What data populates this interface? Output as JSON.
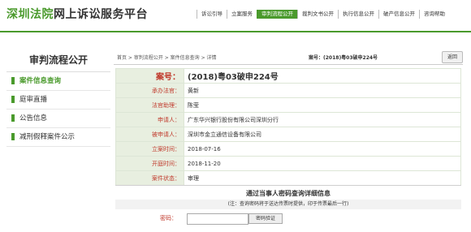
{
  "brand": {
    "part1": "深圳法院",
    "part2": "网上诉讼服务平台"
  },
  "topnav": [
    {
      "label": "诉讼引导",
      "active": false
    },
    {
      "label": "立案服务",
      "active": false
    },
    {
      "label": "审判流程公开",
      "active": true
    },
    {
      "label": "裁判文书公开",
      "active": false
    },
    {
      "label": "执行信息公开",
      "active": false
    },
    {
      "label": "破产信息公开",
      "active": false
    },
    {
      "label": "咨询帮助",
      "active": false
    }
  ],
  "sidebar": {
    "title": "审判流程公开",
    "items": [
      {
        "label": "案件信息查询",
        "active": true
      },
      {
        "label": "庭审直播",
        "active": false
      },
      {
        "label": "公告信息",
        "active": false
      },
      {
        "label": "减刑假释案件公示",
        "active": false
      }
    ]
  },
  "breadcrumb": "首页 > 审判流程公开 > 案件信息查询 > 详情",
  "case_no_header": "案号：(2018)粤03破申224号",
  "back_label": "返回",
  "details": [
    {
      "key": "案号：",
      "value": "(2018)粤03破申224号",
      "big": true
    },
    {
      "key": "承办法官：",
      "value": "黄新",
      "big": false
    },
    {
      "key": "法官助理：",
      "value": "陈莹",
      "big": false
    },
    {
      "key": "申请人：",
      "value": "广东华兴银行股份有限公司深圳分行",
      "big": false
    },
    {
      "key": "被申请人：",
      "value": "深圳市金立通信设备有限公司",
      "big": false
    },
    {
      "key": "立案时间：",
      "value": "2018-07-16",
      "big": false
    },
    {
      "key": "开庭时间：",
      "value": "2018-11-20",
      "big": false
    },
    {
      "key": "案件状态：",
      "value": "审理",
      "big": false
    }
  ],
  "password": {
    "heading": "通过当事人密码查询详细信息",
    "note": "(注：查询密码将于送达传票时提供，印于传票最后一行)",
    "label": "密码：",
    "value": "",
    "button": "密码验证"
  }
}
